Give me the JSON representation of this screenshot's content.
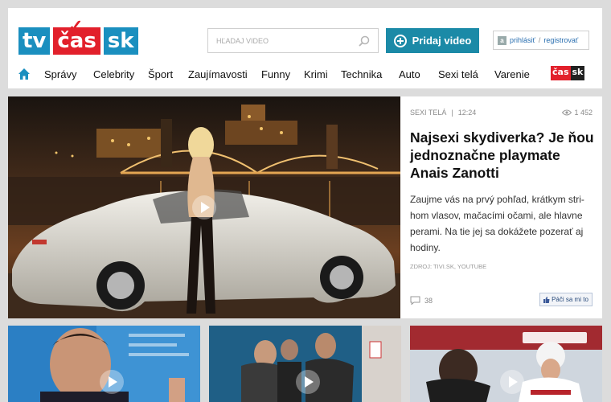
{
  "header": {
    "logo": {
      "tv": "tv",
      "cas": "čas",
      "sk": "sk"
    },
    "search": {
      "placeholder": "HĽADAJ VIDEO"
    },
    "upload_label": "Pridaj video",
    "login": {
      "login_label": "prihlásiť",
      "separator": "/",
      "register_label": "registrovať"
    }
  },
  "nav": {
    "items": [
      {
        "label": "Správy"
      },
      {
        "label": "Celebrity"
      },
      {
        "label": "Šport"
      },
      {
        "label": "Zaujímavosti"
      },
      {
        "label": "Funny"
      },
      {
        "label": "Krimi"
      },
      {
        "label": "Technika"
      },
      {
        "label": "Auto"
      },
      {
        "label": "Sexi telá"
      },
      {
        "label": "Varenie"
      }
    ],
    "brand_logo": {
      "cas": "čas",
      "sk": "sk"
    }
  },
  "featured": {
    "category": "SEXI TELÁ",
    "duration": "12:24",
    "views": "1 452",
    "title": "Najsexi skydiverka? Je ňou jednoznačne playmate Anais Zanotti",
    "excerpt": "Zaujme vás na prvý pohľad, krátkym stri­hom vlasov, mačacími očami, ale hlavne perami. Na tie jej sa dokážete pozerať aj hodiny.",
    "source": "ZDROJ: TIVI.SK, YOUTUBE",
    "comments": "38",
    "like_label": "Páči sa mi to"
  },
  "colors": {
    "brand_blue": "#1a8fbf",
    "brand_red": "#e2202b",
    "button_teal": "#1b8aa7"
  },
  "icons": [
    "search-icon",
    "plus-icon",
    "login-icon",
    "home-icon",
    "eye-icon",
    "comment-icon",
    "like-icon",
    "play-icon"
  ]
}
